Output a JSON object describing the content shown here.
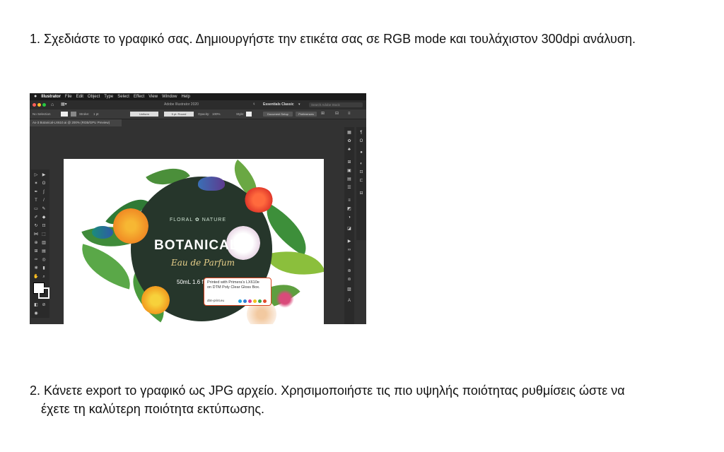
{
  "step1": {
    "text": "1. Σχεδιάστε το γραφικό σας. Δημιουργήστε την ετικέτα σας σε RGB mode και τουλάχιστον 300dpi ανάλυση."
  },
  "step2": {
    "line1": "2. Κάνετε export το γραφικό ως JPG αρχείο. Χρησιμοποιήστε τις πιο υψηλής ποιότητας ρυθμίσεις ώστε να",
    "line2": "έχετε τη καλύτερη ποιότητα εκτύπωσης."
  },
  "app": {
    "menu": [
      "Illustrator",
      "File",
      "Edit",
      "Object",
      "Type",
      "Select",
      "Effect",
      "View",
      "Window",
      "Help"
    ],
    "window_title": "Adobe Illustrator 2020",
    "workspace": "Essentials Classic",
    "search_placeholder": "Search Adobe Stock",
    "control": {
      "selection": "No Selection",
      "stroke_label": "Stroke:",
      "stroke_value": "1 pt",
      "uniform": "Uniform",
      "brush": "5 pt. Round",
      "opacity_label": "Opacity:",
      "opacity_value": "100%",
      "style_label": "Style:",
      "document_setup": "Document Setup",
      "preferences": "Preferences"
    },
    "doc_tab": "Ax-3 Botanical-LX610.ai @ 200% (RGB/GPU Preview)"
  },
  "label": {
    "brand": "FLORAL ✿ NATURE",
    "title": "BOTANICAL",
    "subtitle": "Eau de Parfum",
    "volume": "50mL 1.6 fl",
    "print_line1": "Printed with Primera's LX610e",
    "print_line2": "on DTM Poly Clear Gloss Box.",
    "site": "dtm-print.eu",
    "dot_colors": [
      "#1ea0e0",
      "#2b7bd6",
      "#e03a8c",
      "#f2c21b",
      "#3aa54a",
      "#e24b2b"
    ]
  }
}
